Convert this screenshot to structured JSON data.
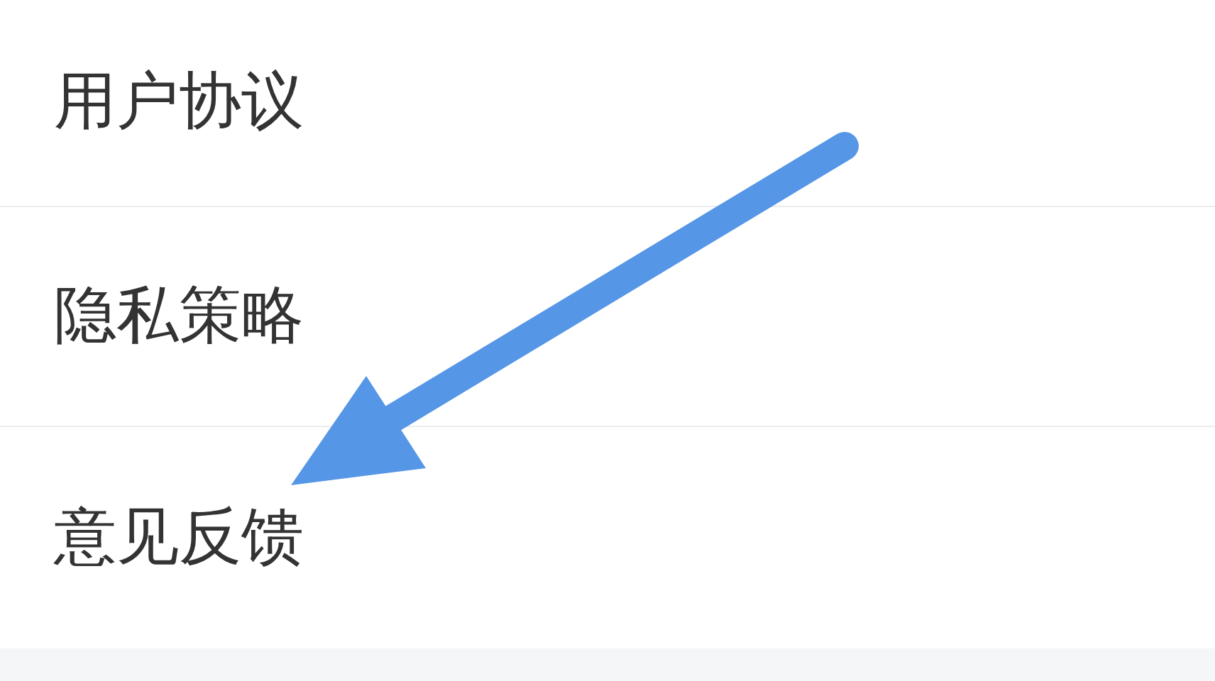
{
  "menu_items": [
    {
      "label": "用户协议"
    },
    {
      "label": "隐私策略"
    },
    {
      "label": "意见反馈"
    }
  ]
}
